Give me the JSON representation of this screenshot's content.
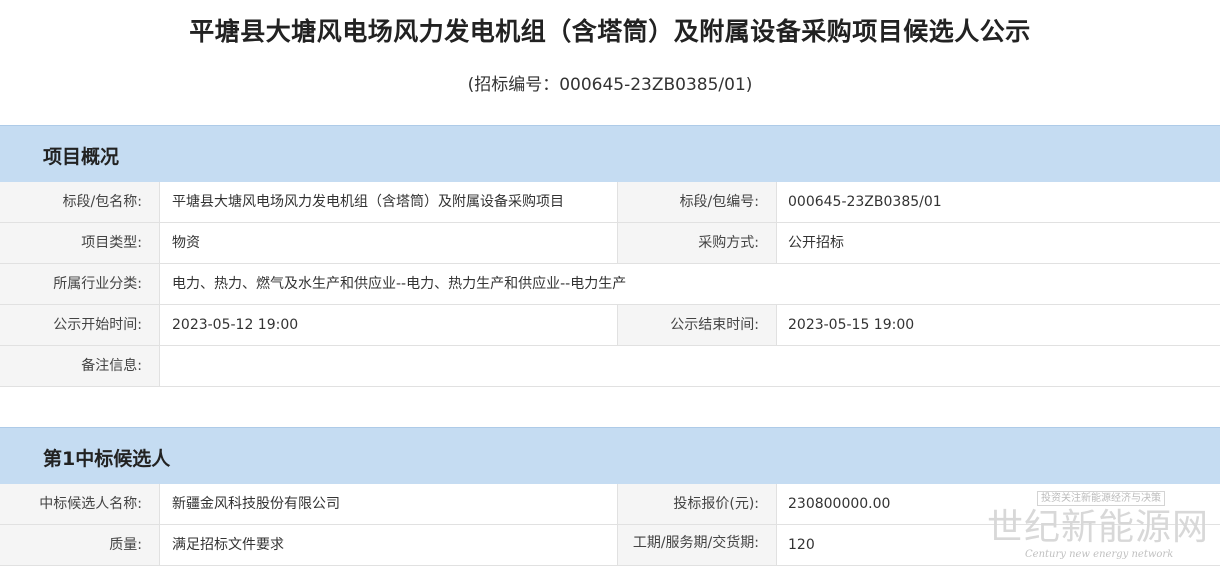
{
  "header": {
    "title": "平塘县大塘风电场风力发电机组（含塔筒）及附属设备采购项目候选人公示",
    "subtitle": "(招标编号：000645-23ZB0385/01)"
  },
  "overview": {
    "heading": "项目概况",
    "rows": [
      {
        "label1": "标段/包名称:",
        "value1": "平塘县大塘风电场风力发电机组（含塔筒）及附属设备采购项目",
        "label2": "标段/包编号:",
        "value2": "000645-23ZB0385/01"
      },
      {
        "label1": "项目类型:",
        "value1": "物资",
        "label2": "采购方式:",
        "value2": "公开招标"
      },
      {
        "label1": "所属行业分类:",
        "value1": "电力、热力、燃气及水生产和供应业--电力、热力生产和供应业--电力生产"
      },
      {
        "label1": "公示开始时间:",
        "value1": "2023-05-12 19:00",
        "label2": "公示结束时间:",
        "value2": "2023-05-15 19:00"
      },
      {
        "label1": "备注信息:",
        "value1": ""
      }
    ]
  },
  "candidate1": {
    "heading": "第1中标候选人",
    "rows": [
      {
        "label1": "中标候选人名称:",
        "value1": "新疆金风科技股份有限公司",
        "label2": "投标报价(元):",
        "value2": "230800000.00"
      },
      {
        "label1": "质量:",
        "value1": "满足招标文件要求",
        "label2": "工期/服务期/交货期:",
        "value2": "120"
      }
    ]
  },
  "watermark": {
    "tagline": "投资关注新能源经济与决策",
    "name": "世纪新能源网",
    "english": "Century new energy network"
  }
}
